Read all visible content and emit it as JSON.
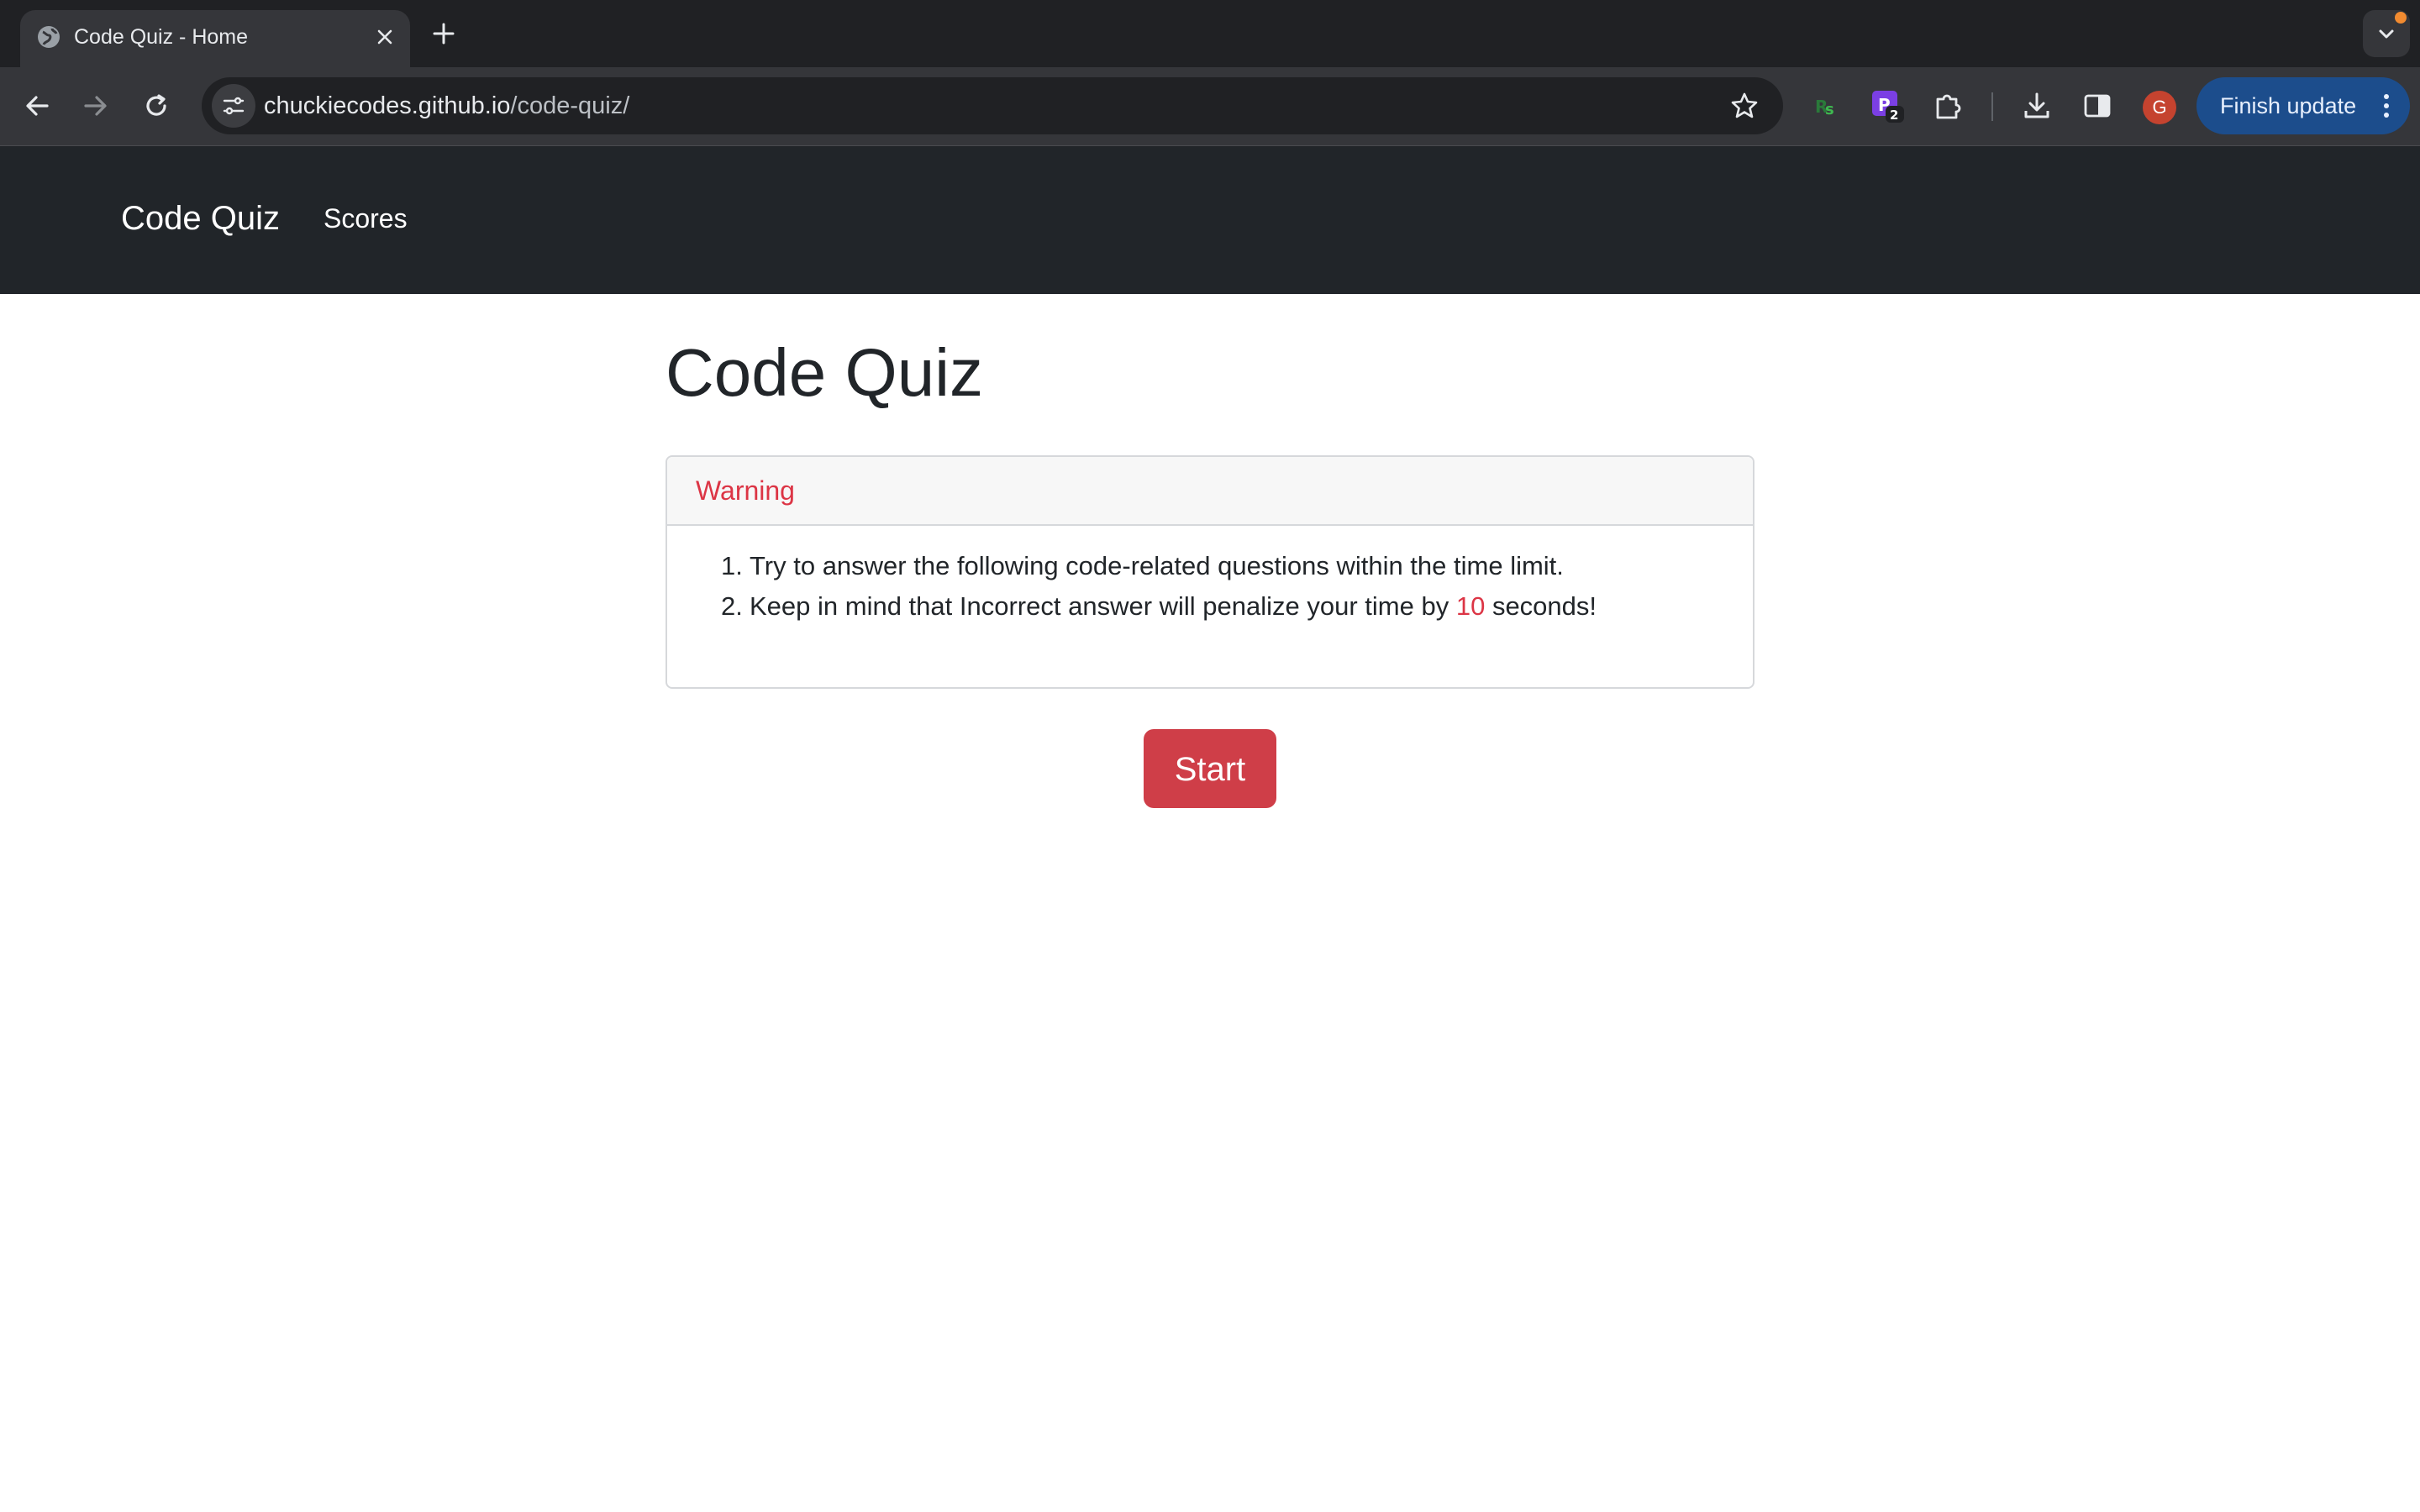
{
  "browser": {
    "tab": {
      "title": "Code Quiz - Home"
    },
    "url": {
      "host": "chuckiecodes.github.io",
      "path": "/code-quiz/"
    },
    "extensions": {
      "p_badge": "2"
    },
    "profile": {
      "initial": "G"
    },
    "update_button": {
      "label": "Finish update"
    },
    "colors": {
      "update_button": "#1c4d8c",
      "avatar": "#c5432f",
      "notification_dot": "#f28b30"
    }
  },
  "site": {
    "brand": "Code Quiz",
    "nav": {
      "scores_label": "Scores"
    }
  },
  "main": {
    "title": "Code Quiz",
    "card": {
      "header": "Warning",
      "rules": [
        {
          "number": "1.",
          "text": "Try to answer the following code-related questions within the time limit."
        },
        {
          "number": "2.",
          "before": "Keep in mind that Incorrect answer will penalize your time by ",
          "highlight": "10",
          "after": " seconds!"
        }
      ]
    },
    "start_button": {
      "label": "Start"
    }
  },
  "colors": {
    "accent_red": "#dc3545",
    "navbar": "#212529",
    "button": "#cf3e48"
  }
}
